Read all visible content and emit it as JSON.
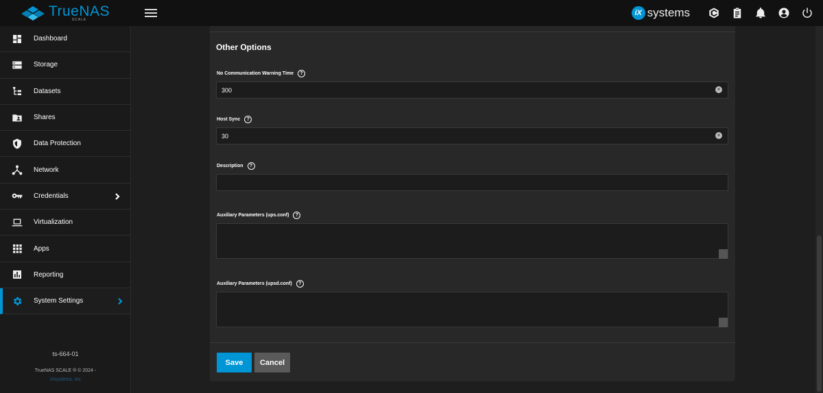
{
  "brand": {
    "name": "TrueNAS",
    "edition": "SCALE"
  },
  "topbar": {
    "menu_icon": "hamburger-icon",
    "partner_badge": "iX",
    "partner_word": "systems",
    "icons": [
      "truecommand-icon",
      "clipboard-icon",
      "bell-icon",
      "account-icon",
      "power-icon"
    ]
  },
  "sidebar": {
    "items": [
      {
        "label": "Dashboard",
        "icon": "dashboard-icon"
      },
      {
        "label": "Storage",
        "icon": "storage-icon"
      },
      {
        "label": "Datasets",
        "icon": "datasets-icon"
      },
      {
        "label": "Shares",
        "icon": "shares-icon"
      },
      {
        "label": "Data Protection",
        "icon": "shield-icon"
      },
      {
        "label": "Network",
        "icon": "network-icon"
      },
      {
        "label": "Credentials",
        "icon": "key-icon",
        "has_children": true
      },
      {
        "label": "Virtualization",
        "icon": "laptop-icon"
      },
      {
        "label": "Apps",
        "icon": "apps-grid-icon"
      },
      {
        "label": "Reporting",
        "icon": "chart-icon"
      },
      {
        "label": "System Settings",
        "icon": "gear-icon",
        "has_children": true,
        "active": true
      }
    ],
    "footer": {
      "hostname": "ts-664-01",
      "copyright": "TrueNAS SCALE ® © 2024 -",
      "company": "iXsystems, Inc"
    }
  },
  "form": {
    "section_title": "Other Options",
    "fields": {
      "no_comm_warning": {
        "label": "No Communication Warning Time",
        "value": "300"
      },
      "host_sync": {
        "label": "Host Sync",
        "value": "30"
      },
      "description": {
        "label": "Description",
        "value": ""
      },
      "aux_ups": {
        "label": "Auxiliary Parameters (ups.conf)",
        "value": ""
      },
      "aux_upsd": {
        "label": "Auxiliary Parameters (upsd.conf)",
        "value": ""
      }
    },
    "buttons": {
      "save": "Save",
      "cancel": "Cancel"
    }
  },
  "colors": {
    "accent": "#0095d5",
    "background": "#1e1e1e",
    "panel": "#282828",
    "topbar": "#111111"
  }
}
